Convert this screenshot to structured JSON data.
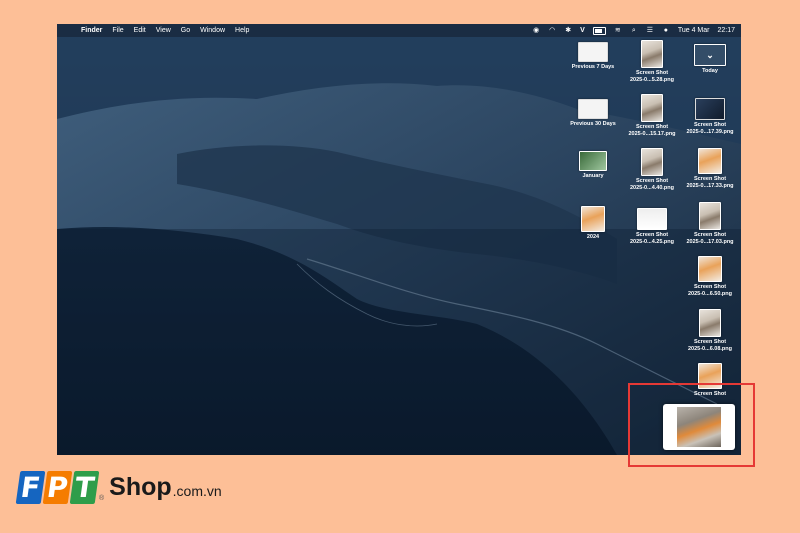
{
  "menubar": {
    "apple": "",
    "items": [
      "Finder",
      "File",
      "Edit",
      "View",
      "Go",
      "Window",
      "Help"
    ],
    "status": {
      "v_label": "V",
      "date": "Tue 4 Mar",
      "time": "22:17"
    }
  },
  "desktop": {
    "items": [
      {
        "label": "Previous 7 Days",
        "kind": "stack"
      },
      {
        "label": "Screen Shot 2025-0...5.28.png",
        "line1": "Screen Shot",
        "line2": "2025-0...5.28.png",
        "kind": "shot"
      },
      {
        "label": "Today",
        "kind": "folder"
      },
      {
        "label": "Previous 30 Days",
        "kind": "stack"
      },
      {
        "line1": "Screen Shot",
        "line2": "2025-0...15.17.png",
        "kind": "shot"
      },
      {
        "line1": "Screen Shot",
        "line2": "2025-0...17.39.png",
        "kind": "shot"
      },
      {
        "label": "January",
        "kind": "stack"
      },
      {
        "line1": "Screen Shot",
        "line2": "2025-0...4.40.png",
        "kind": "shot"
      },
      {
        "line1": "Screen Shot",
        "line2": "2025-0...17.33.png",
        "kind": "shot"
      },
      {
        "label": "2024",
        "kind": "stack"
      },
      {
        "line1": "Screen Shot",
        "line2": "2025-0...4.25.png",
        "kind": "shot"
      },
      {
        "line1": "Screen Shot",
        "line2": "2025-0...17.03.png",
        "kind": "shot"
      },
      {
        "line1": "Screen Shot",
        "line2": "2025-0...6.50.png",
        "kind": "shot"
      },
      {
        "line1": "Screen Shot",
        "line2": "2025-0...6.08.png",
        "kind": "shot"
      },
      {
        "line1": "Screen Shot",
        "line2": "",
        "kind": "shot"
      }
    ]
  },
  "highlight_color": "#e53935",
  "logo": {
    "letters": [
      "F",
      "P",
      "T"
    ],
    "shop": "Shop",
    "domain": ".com.vn",
    "reg": "®"
  },
  "colors": {
    "background": "#FDBF97",
    "fpt_blue": "#1565c0",
    "fpt_orange": "#f57c00",
    "fpt_green": "#2e9d4a"
  }
}
